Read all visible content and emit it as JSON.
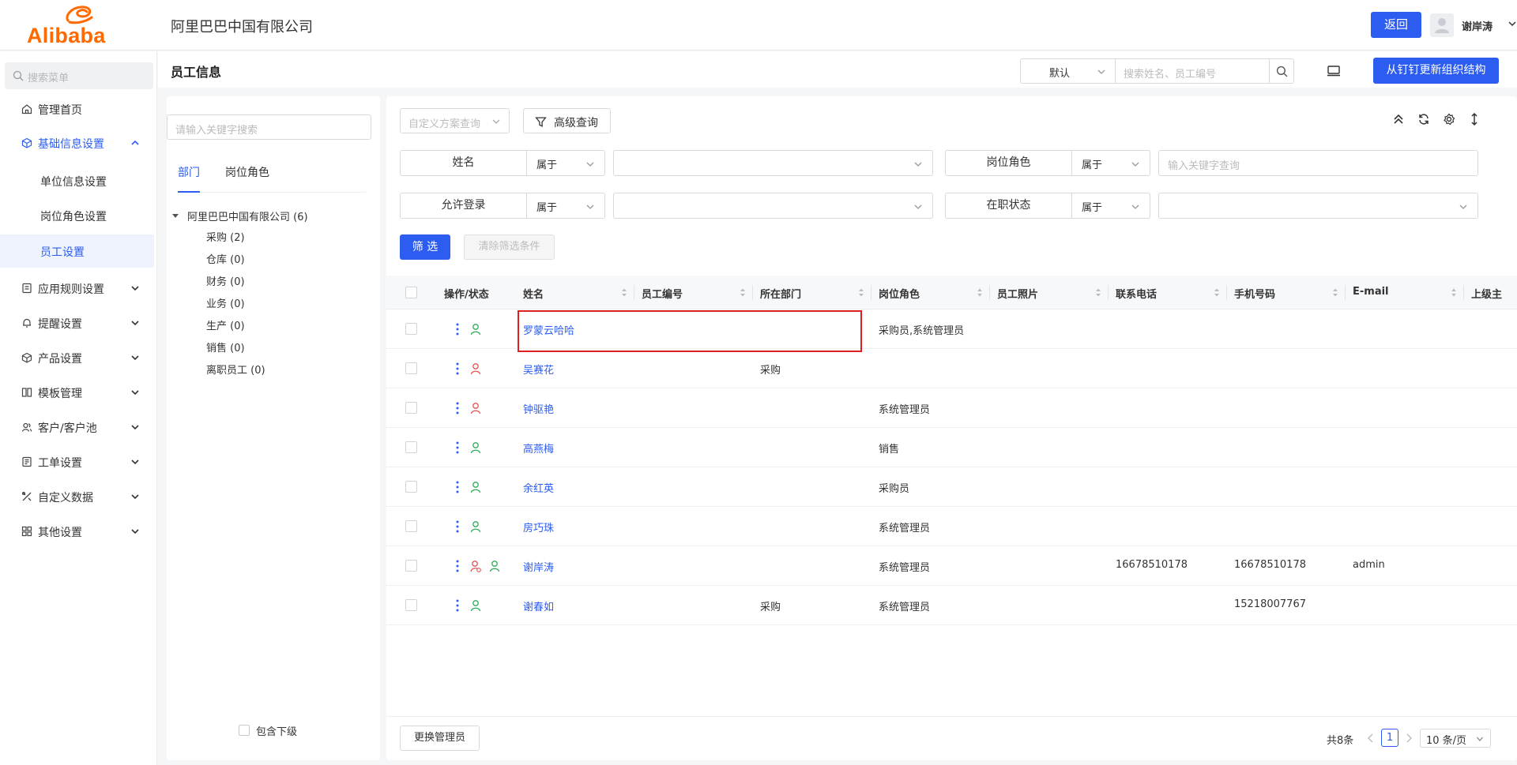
{
  "header": {
    "logo_text": "Alibaba",
    "company": "阿里巴巴中国有限公司",
    "back_label": "返回",
    "user_name": "谢岸涛"
  },
  "sidebar": {
    "search_placeholder": "搜索菜单",
    "items": [
      {
        "label": "管理首页",
        "icon": "home-icon"
      },
      {
        "label": "基础信息设置",
        "icon": "cube-icon",
        "expanded": true
      },
      {
        "label": "单位信息设置"
      },
      {
        "label": "岗位角色设置"
      },
      {
        "label": "员工设置",
        "selected": true
      },
      {
        "label": "应用规则设置",
        "icon": "doc-icon"
      },
      {
        "label": "提醒设置",
        "icon": "bell-icon"
      },
      {
        "label": "产品设置",
        "icon": "box-icon"
      },
      {
        "label": "模板管理",
        "icon": "layout-icon"
      },
      {
        "label": "客户/客户池",
        "icon": "users-icon"
      },
      {
        "label": "工单设置",
        "icon": "ticket-icon"
      },
      {
        "label": "自定义数据",
        "icon": "tools-icon"
      },
      {
        "label": "其他设置",
        "icon": "grid-icon"
      }
    ]
  },
  "page": {
    "title": "员工信息",
    "scheme_value": "默认",
    "search_placeholder": "搜索姓名、员工编号",
    "sync_label": "从钉钉更新组织结构"
  },
  "tree": {
    "search_placeholder": "请输入关键字搜索",
    "tabs": [
      "部门",
      "岗位角色"
    ],
    "root": "阿里巴巴中国有限公司 (6)",
    "children": [
      "采购 (2)",
      "仓库 (0)",
      "财务 (0)",
      "业务 (0)",
      "生产 (0)",
      "销售 (0)",
      "离职员工 (0)"
    ],
    "include_sub_label": "包含下级"
  },
  "query": {
    "custom_placeholder": "自定义方案查询",
    "advanced_label": "高级查询",
    "filters": [
      {
        "label": "姓名",
        "op": "属于",
        "placeholder": ""
      },
      {
        "label": "岗位角色",
        "op": "属于",
        "placeholder": "输入关键字查询"
      },
      {
        "label": "允许登录",
        "op": "属于",
        "placeholder": ""
      },
      {
        "label": "在职状态",
        "op": "属于",
        "placeholder": ""
      }
    ],
    "filter_btn": "筛 选",
    "clear_btn": "清除筛选条件"
  },
  "table": {
    "columns": [
      "操作/状态",
      "姓名",
      "员工编号",
      "所在部门",
      "岗位角色",
      "员工照片",
      "联系电话",
      "手机号码",
      "E-mail",
      "上级主"
    ],
    "rows": [
      {
        "name": "罗蒙云哈哈",
        "dept": "",
        "role": "采购员,系统管理员",
        "phone": "",
        "mobile": "",
        "email": "",
        "status": [
          "green"
        ]
      },
      {
        "name": "吴赛花",
        "dept": "采购",
        "role": "",
        "phone": "",
        "mobile": "",
        "email": "",
        "status": [
          "red"
        ]
      },
      {
        "name": "钟驱艳",
        "dept": "",
        "role": "系统管理员",
        "phone": "",
        "mobile": "",
        "email": "",
        "status": [
          "red"
        ]
      },
      {
        "name": "高燕梅",
        "dept": "",
        "role": "销售",
        "phone": "",
        "mobile": "",
        "email": "",
        "status": [
          "green"
        ]
      },
      {
        "name": "余红英",
        "dept": "",
        "role": "采购员",
        "phone": "",
        "mobile": "",
        "email": "",
        "status": [
          "green"
        ]
      },
      {
        "name": "房巧珠",
        "dept": "",
        "role": "系统管理员",
        "phone": "",
        "mobile": "",
        "email": "",
        "status": [
          "green"
        ]
      },
      {
        "name": "谢岸涛",
        "dept": "",
        "role": "系统管理员",
        "phone": "16678510178",
        "mobile": "16678510178",
        "email": "admin",
        "status": [
          "red-clock",
          "green"
        ]
      },
      {
        "name": "谢春如",
        "dept": "采购",
        "role": "系统管理员",
        "phone": "",
        "mobile": "15218007767",
        "email": "",
        "status": [
          "green"
        ]
      }
    ]
  },
  "footer": {
    "switch_admin": "更换管理员",
    "total": "共8条",
    "page": "1",
    "page_size": "10 条/页"
  },
  "colors": {
    "primary": "#2c5cf0",
    "brand": "#ff6a00",
    "status_green": "#2eaa5c",
    "status_red": "#e25353",
    "highlight": "#e02020"
  }
}
